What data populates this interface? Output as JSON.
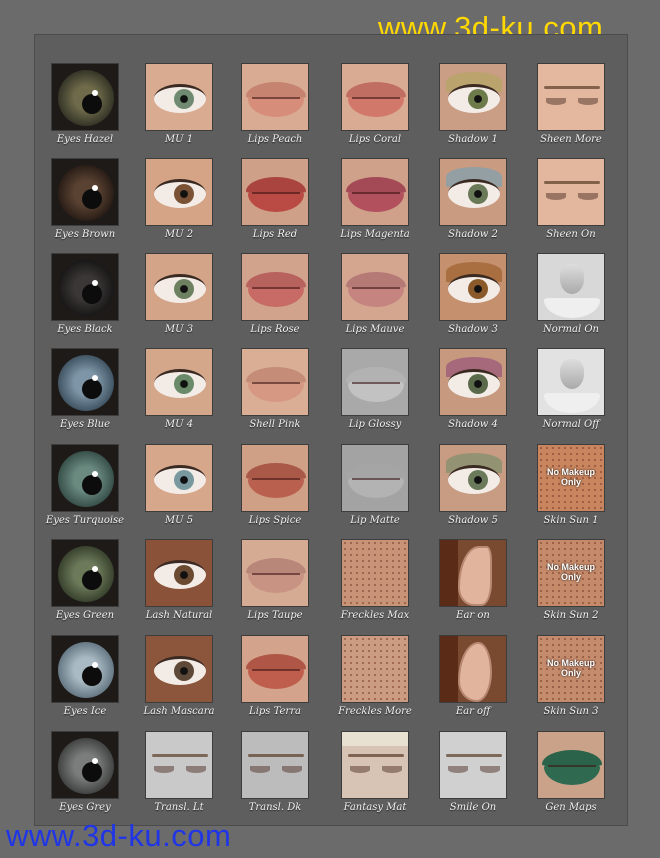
{
  "watermark_top": "www.3d-ku.com",
  "watermark_bottom": "www.3d-ku.com",
  "colors": {
    "background": "#6b6b6b",
    "panel": "#5e5e5e",
    "watermark_top": "#ffd800",
    "watermark_bottom": "#1f35e6"
  },
  "columns": [
    [
      {
        "label": "Eyes Hazel",
        "kind": "iris",
        "c1": "#6e6a4a",
        "c2": "#2f3024"
      },
      {
        "label": "Eyes Brown",
        "kind": "iris",
        "c1": "#5a4232",
        "c2": "#251a14"
      },
      {
        "label": "Eyes Black",
        "kind": "iris",
        "c1": "#3a3736",
        "c2": "#151414"
      },
      {
        "label": "Eyes Blue",
        "kind": "iris",
        "c1": "#7d95a6",
        "c2": "#3a4d5c"
      },
      {
        "label": "Eyes Turquoise",
        "kind": "iris",
        "c1": "#6a8a80",
        "c2": "#334a45"
      },
      {
        "label": "Eyes Green",
        "kind": "iris",
        "c1": "#6d7a5a",
        "c2": "#333c29"
      },
      {
        "label": "Eyes Ice",
        "kind": "iris",
        "c1": "#a9bac4",
        "c2": "#5f717d"
      },
      {
        "label": "Eyes Grey",
        "kind": "iris",
        "c1": "#7a7d7b",
        "c2": "#3c3e3d"
      }
    ],
    [
      {
        "label": "MU 1",
        "kind": "eye",
        "skin": "#d9ab90",
        "iris": "#6f8a70"
      },
      {
        "label": "MU 2",
        "kind": "eye",
        "skin": "#d5a486",
        "iris": "#7a5236"
      },
      {
        "label": "MU 3",
        "kind": "eye",
        "skin": "#d3a488",
        "iris": "#6d8060"
      },
      {
        "label": "MU 4",
        "kind": "eye",
        "skin": "#d4a68a",
        "iris": "#6a8a6a"
      },
      {
        "label": "MU 5",
        "kind": "eye",
        "skin": "#d7a78c",
        "iris": "#7a98a0"
      },
      {
        "label": "Lash Natural",
        "kind": "eye",
        "skin": "#8a5238",
        "iris": "#6a4a30"
      },
      {
        "label": "Lash Mascara",
        "kind": "eye",
        "skin": "#8c563c",
        "iris": "#5e4838"
      },
      {
        "label": "Transl. Lt",
        "kind": "face",
        "skin": "#c9c9c9"
      }
    ],
    [
      {
        "label": "Lips Peach",
        "kind": "lips",
        "skin": "#d9ab92",
        "lip": "#d68e7a"
      },
      {
        "label": "Lips Red",
        "kind": "lips",
        "skin": "#cfa088",
        "lip": "#b94a44"
      },
      {
        "label": "Lips Rose",
        "kind": "lips",
        "skin": "#d2a38c",
        "lip": "#c86a66"
      },
      {
        "label": "Shell Pink",
        "kind": "lips",
        "skin": "#d9ae95",
        "lip": "#d69882"
      },
      {
        "label": "Lips Spice",
        "kind": "lips",
        "skin": "#cf9f86",
        "lip": "#b9604e"
      },
      {
        "label": "Lips Taupe",
        "kind": "lips",
        "skin": "#d6ab93",
        "lip": "#c99384"
      },
      {
        "label": "Lips Terra",
        "kind": "lips",
        "skin": "#d3a48b",
        "lip": "#bf5e4c"
      },
      {
        "label": "Transl. Dk",
        "kind": "face",
        "skin": "#bcbcbc"
      }
    ],
    [
      {
        "label": "Lips Coral",
        "kind": "lips",
        "skin": "#d9ab92",
        "lip": "#d2786a"
      },
      {
        "label": "Lips Magenta",
        "kind": "lips",
        "skin": "#cfa08a",
        "lip": "#b2505e"
      },
      {
        "label": "Lips Mauve",
        "kind": "lips",
        "skin": "#d4a690",
        "lip": "#c58480"
      },
      {
        "label": "Lip Glossy",
        "kind": "lips",
        "skin": "#a9a9a9",
        "lip": "#c2c2c2"
      },
      {
        "label": "Lip Matte",
        "kind": "lips",
        "skin": "#a3a3a3",
        "lip": "#b3b3b3"
      },
      {
        "label": "Freckles Max",
        "kind": "skin",
        "skin": "#c89478"
      },
      {
        "label": "Freckles More",
        "kind": "skin",
        "skin": "#cc9c82"
      },
      {
        "label": "Fantasy Mat",
        "kind": "fantasy",
        "skin": "#d8c4b4"
      }
    ],
    [
      {
        "label": "Shadow 1",
        "kind": "eye",
        "skin": "#c99e84",
        "iris": "#6d7a4a",
        "shadow": "#b8a36a"
      },
      {
        "label": "Shadow 2",
        "kind": "eye",
        "skin": "#c99c82",
        "iris": "#6a7a58",
        "shadow": "#8aa0a8"
      },
      {
        "label": "Shadow 3",
        "kind": "eye",
        "skin": "#c4906e",
        "iris": "#8a5a2a",
        "shadow": "#a56a3a"
      },
      {
        "label": "Shadow 4",
        "kind": "eye",
        "skin": "#c79a80",
        "iris": "#5a6a4a",
        "shadow": "#a0607a"
      },
      {
        "label": "Shadow 5",
        "kind": "eye",
        "skin": "#c89c82",
        "iris": "#6a7a5a",
        "shadow": "#8a9070"
      },
      {
        "label": "Ear on",
        "kind": "ear",
        "skin": "#e0b49d"
      },
      {
        "label": "Ear off",
        "kind": "ear",
        "skin": "#e0b49d"
      },
      {
        "label": "Smile On",
        "kind": "face",
        "skin": "#d0d0d0"
      }
    ],
    [
      {
        "label": "Sheen More",
        "kind": "sheen",
        "skin": "#e3b89e"
      },
      {
        "label": "Sheen On",
        "kind": "sheen",
        "skin": "#e2b79e"
      },
      {
        "label": "Normal On",
        "kind": "normal",
        "skin": "#d8d8d8"
      },
      {
        "label": "Normal Off",
        "kind": "normal",
        "skin": "#e2e2e2"
      },
      {
        "label": "Skin Sun 1",
        "kind": "sun",
        "skin": "#c8855e",
        "note": "No Makeup Only"
      },
      {
        "label": "Skin Sun 2",
        "kind": "sun",
        "skin": "#c58a6a",
        "note": "No Makeup Only"
      },
      {
        "label": "Skin Sun 3",
        "kind": "sun",
        "skin": "#c48b6c",
        "note": "No Makeup Only"
      },
      {
        "label": "Gen Maps",
        "kind": "gen",
        "skin": "#c9a289"
      }
    ]
  ]
}
